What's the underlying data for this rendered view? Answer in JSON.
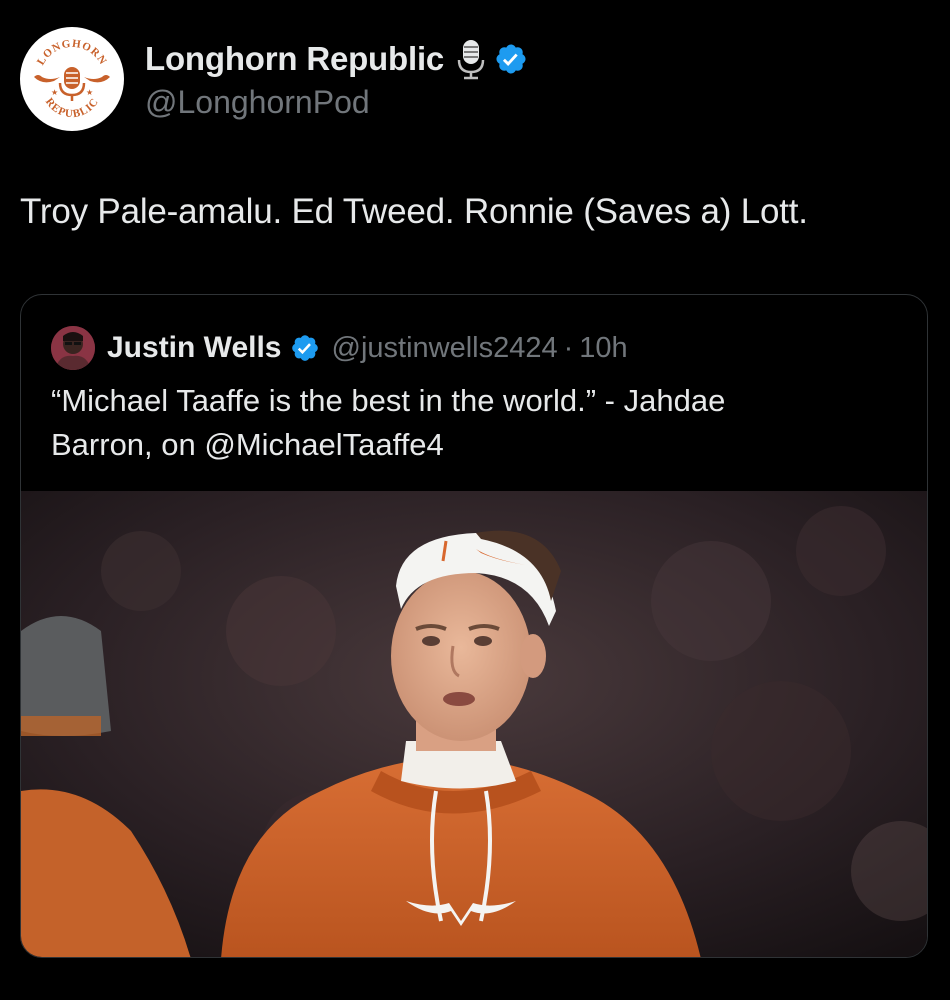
{
  "tweet": {
    "author": {
      "display_name": "Longhorn Republic",
      "handle": "@LonghornPod",
      "avatar": {
        "icon": "longhorn-republic-logo",
        "top_text": "LONGHORN",
        "bottom_text": "REPUBLIC"
      },
      "name_icons": [
        "microphone-icon",
        "verified-badge-icon"
      ]
    },
    "text": "Troy Pale-amalu. Ed Tweed. Ronnie (Saves a) Lott.",
    "quoted_tweet": {
      "author": {
        "display_name": "Justin Wells",
        "handle": "@justinwells2424",
        "avatar_icon": "user-avatar"
      },
      "separator": "·",
      "time": "10h",
      "text_lines": [
        "“Michael Taaffe is the best in the world.” - Jahdae",
        "Barron, on @MichaelTaaffe4"
      ],
      "media": {
        "type": "photo",
        "subject": "football player in burnt orange hoodie and white headband"
      }
    }
  },
  "colors": {
    "background": "#000000",
    "primary_text": "#e7e9ea",
    "secondary_text": "#71767b",
    "border": "#2f3336",
    "verified": "#1d9bf0",
    "burnt_orange": "#c8612b"
  }
}
